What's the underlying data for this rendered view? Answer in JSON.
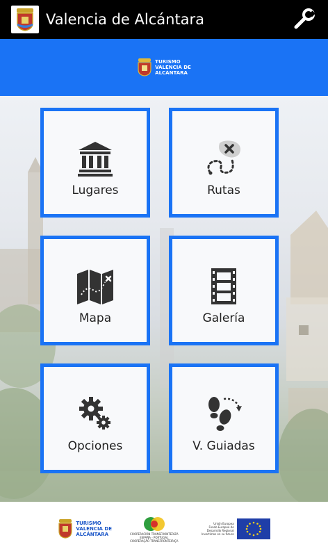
{
  "app": {
    "title": "Valencia de Alcántara"
  },
  "toolbar": {
    "settings_icon": "wrench-icon"
  },
  "banner": {
    "line1": "TURISMO",
    "line2": "VALENCIA DE",
    "line3": "ALCÁNTARA"
  },
  "tiles": [
    {
      "label": "Lugares",
      "icon": "bank-icon"
    },
    {
      "label": "Rutas",
      "icon": "route-icon"
    },
    {
      "label": "Mapa",
      "icon": "map-icon"
    },
    {
      "label": "Galería",
      "icon": "film-icon"
    },
    {
      "label": "Opciones",
      "icon": "gears-icon"
    },
    {
      "label": "V. Guiadas",
      "icon": "footsteps-icon"
    }
  ],
  "footer": {
    "turismo": {
      "line1": "TURISMO",
      "line2": "VALENCIA DE",
      "line3": "ALCÁNTARA"
    },
    "poctep": {
      "line1": "COOPERACIÓN TRANSFRONTERIZA",
      "line2": "ESPAÑA - PORTUGAL",
      "line3": "COOPERAÇÃO TRANSFRONTEIRIÇA"
    },
    "eu": {
      "line1": "Unión Europea",
      "line2": "Fondo Europeo de",
      "line3": "Desarrollo Regional",
      "line4": "Invertimos en su futuro"
    }
  },
  "colors": {
    "accent": "#1a73f5",
    "appbar": "#000000",
    "tile_bg": "#f8f9fb"
  }
}
